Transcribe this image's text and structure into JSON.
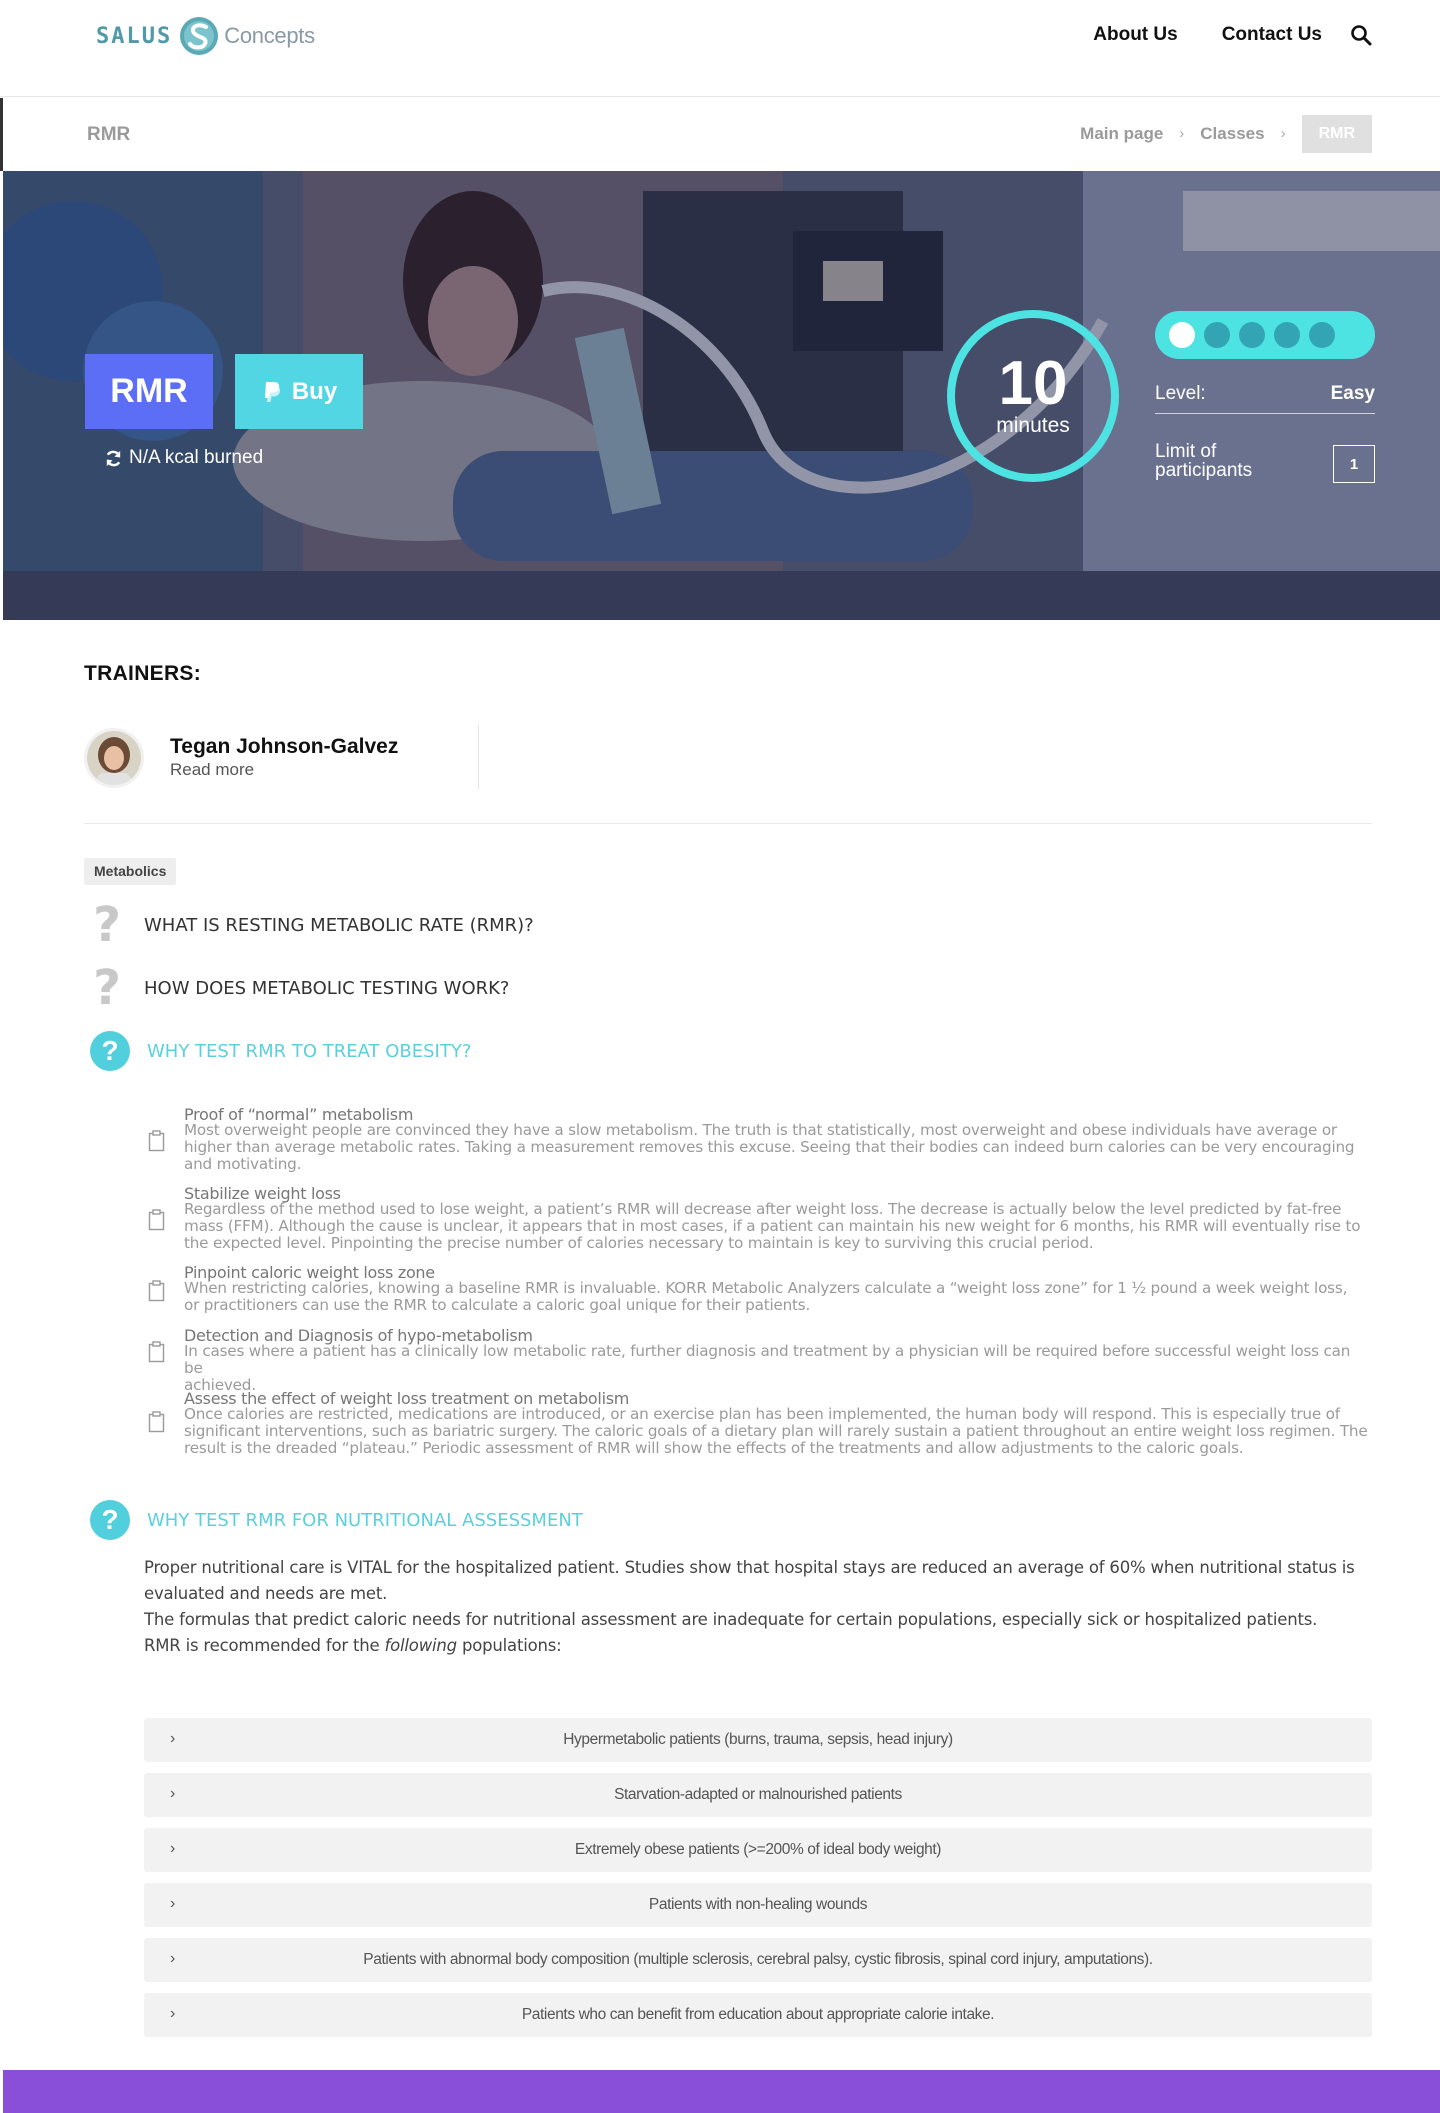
{
  "brand": {
    "name_left": "SALUS",
    "name_right": "Concepts"
  },
  "nav": {
    "items": [
      "About Us",
      "Contact Us"
    ]
  },
  "page": {
    "title": "RMR"
  },
  "breadcrumb": {
    "items": [
      "Main page",
      "Classes"
    ],
    "current": "RMR"
  },
  "hero": {
    "badge": "RMR",
    "buy_label": "Buy",
    "kcal": "N/A kcal burned",
    "duration_value": "10",
    "duration_unit": "minutes",
    "difficulty_dots": 1,
    "difficulty_total": 5,
    "level_label": "Level:",
    "level_value": "Easy",
    "limit_label_1": "Limit of",
    "limit_label_2": "participants",
    "limit_value": "1",
    "colors": {
      "badge": "#5b6ef5",
      "buy": "#52d6e3",
      "accent": "#4ee3e3"
    }
  },
  "trainers": {
    "title": "TRAINERS:",
    "items": [
      {
        "name": "Tegan Johnson-Galvez",
        "more": "Read more"
      }
    ]
  },
  "tag": "Metabolics",
  "faq": [
    {
      "title": "WHAT IS RESTING METABOLIC RATE (RMR)?",
      "open": false
    },
    {
      "title": "HOW DOES METABOLIC TESTING WORK?",
      "open": false
    },
    {
      "title": "WHY TEST RMR TO TREAT OBESITY?",
      "open": true
    },
    {
      "title": "WHY TEST RMR FOR NUTRITIONAL ASSESSMENT",
      "open": true
    }
  ],
  "obesity_benefits": [
    {
      "title": "Proof of “normal” metabolism",
      "lines": [
        "Most overweight people are convinced they have a slow metabolism. The truth is that statistically, most overweight and obese individuals have average or",
        "higher than average metabolic rates. Taking a measurement removes this excuse. Seeing that their bodies can indeed burn calories can be very encouraging",
        "and motivating."
      ]
    },
    {
      "title": "Stabilize weight loss",
      "lines": [
        "Regardless of the method used to lose weight, a patient’s RMR will decrease after weight loss. The decrease is actually below the level predicted by fat-free",
        "mass (FFM). Although the cause is unclear, it appears that in most cases, if a patient can maintain his new weight for 6 months, his RMR will eventually rise to",
        "the expected level. Pinpointing the precise number of calories necessary to maintain is key to surviving this crucial period."
      ]
    },
    {
      "title": "Pinpoint caloric weight loss zone",
      "lines": [
        "When restricting calories, knowing a baseline RMR is invaluable. KORR Metabolic Analyzers calculate a “weight loss zone” for 1 ½ pound a week weight loss,",
        "or practitioners can use the RMR to calculate a caloric goal unique for their patients."
      ]
    },
    {
      "title": "Detection and Diagnosis of hypo-metabolism",
      "lines": [
        "In cases where a patient has a clinically low metabolic rate, further diagnosis and treatment by a physician will be required before successful weight loss can be",
        "achieved."
      ]
    },
    {
      "title": "Assess the effect of weight loss treatment on metabolism",
      "lines": [
        "Once calories are restricted, medications are introduced, or an exercise plan has been implemented, the human body will respond. This is especially true of",
        "significant interventions, such as bariatric surgery. The caloric goals of a dietary plan will rarely sustain a patient throughout an entire weight loss regimen. The",
        "result is the dreaded “plateau.” Periodic assessment of RMR will show the effects of the treatments and allow adjustments to the caloric goals."
      ]
    }
  ],
  "nutrition": {
    "p1_line1": "Proper nutritional care is VITAL for the hospitalized patient. Studies show that hospital stays are reduced an average of 60% when nutritional status is",
    "p1_line2": "evaluated and needs are met.",
    "p2": "The formulas that predict caloric needs for nutritional assessment are inadequate for certain populations, especially sick or hospitalized patients.",
    "p3_before": "RMR is recommended for the ",
    "p3_em": "following",
    "p3_after": " populations:"
  },
  "populations": [
    "Hypermetabolic patients (burns, trauma, sepsis, head injury)",
    "Starvation-adapted or malnourished patients",
    "Extremely obese patients (>=200% of ideal body weight)",
    "Patients with non-healing wounds",
    "Patients with abnormal body composition (multiple sclerosis, cerebral palsy, cystic fibrosis, spinal cord injury, amputations).",
    "Patients who can benefit from education about appropriate calorie intake."
  ],
  "icons": [
    "search-icon",
    "paypal-icon",
    "refresh-icon",
    "question-icon",
    "clipboard-icon",
    "chevron-right-icon"
  ]
}
